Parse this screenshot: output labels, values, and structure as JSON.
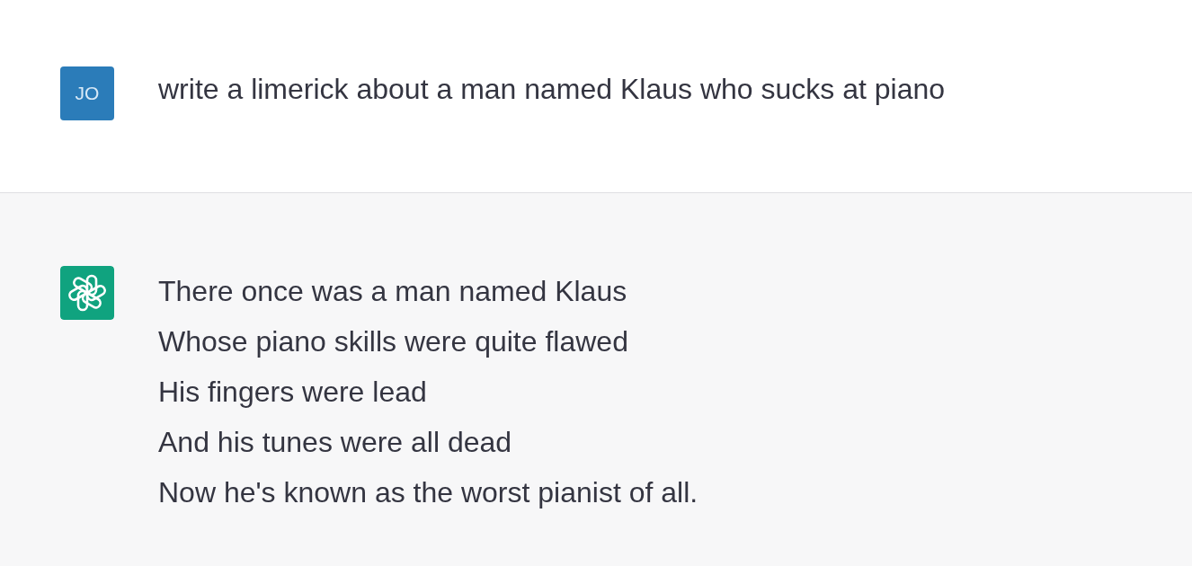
{
  "messages": [
    {
      "kind": "user",
      "avatar": {
        "initials": "JO"
      },
      "lines": [
        "write a limerick about a man named Klaus who sucks at piano"
      ]
    },
    {
      "kind": "assistant",
      "lines": [
        "There once was a man named Klaus",
        "Whose piano skills were quite flawed",
        "His fingers were lead",
        "And his tunes were all dead",
        "Now he's known as the worst pianist of all."
      ]
    }
  ]
}
